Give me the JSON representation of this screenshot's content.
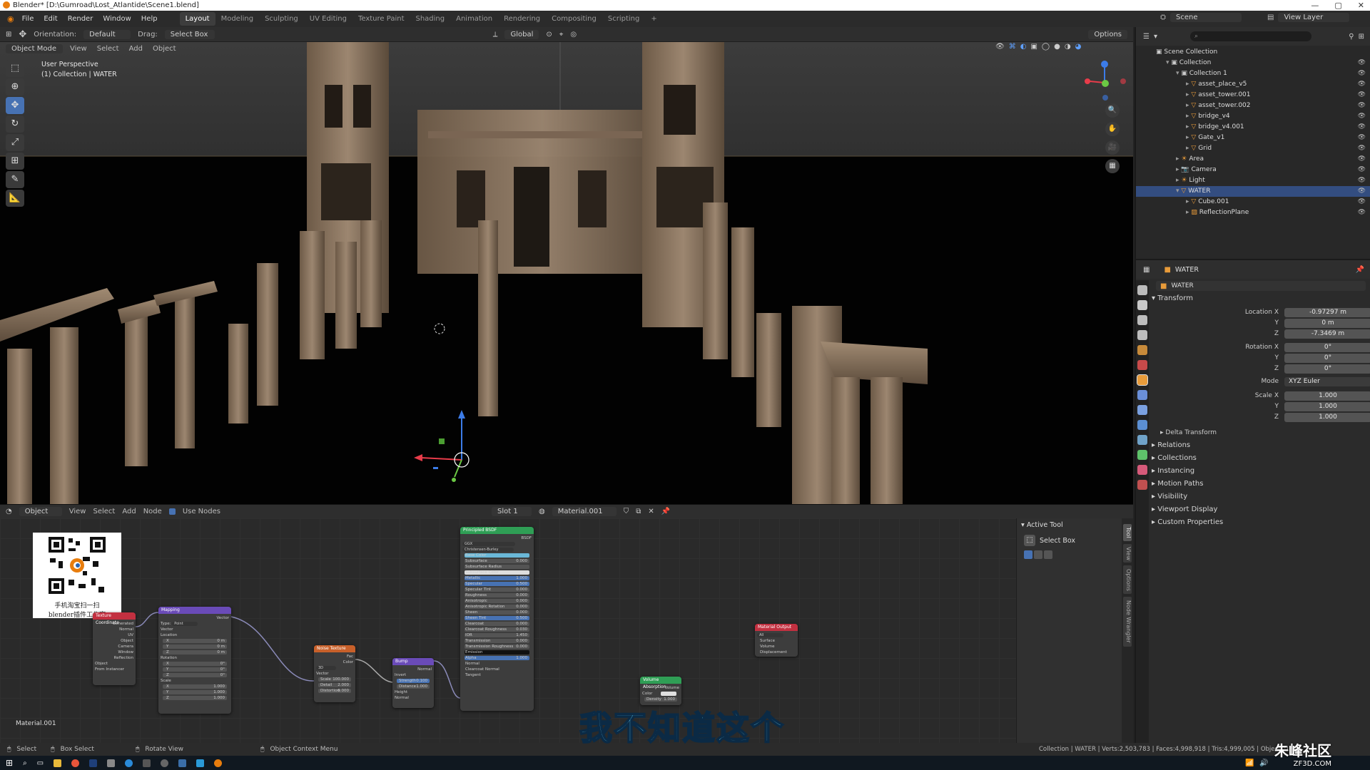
{
  "window": {
    "title": "Blender* [D:\\Gumroad\\Lost_Atlantide\\Scene1.blend]"
  },
  "menubar": {
    "menus": [
      "File",
      "Edit",
      "Render",
      "Window",
      "Help"
    ],
    "workspaces": [
      "Layout",
      "Modeling",
      "Sculpting",
      "UV Editing",
      "Texture Paint",
      "Shading",
      "Animation",
      "Rendering",
      "Compositing",
      "Scripting"
    ],
    "active_workspace": "Layout",
    "scene_label": "Scene",
    "view_layer_label": "View Layer"
  },
  "tool_header": {
    "orientation_label": "Orientation:",
    "orientation_value": "Default",
    "drag_label": "Drag:",
    "drag_value": "Select Box",
    "transform_space": "Global",
    "options_label": "Options"
  },
  "viewport": {
    "mode": "Object Mode",
    "menus": [
      "View",
      "Select",
      "Add",
      "Object"
    ],
    "info_line1": "User Perspective",
    "info_line2": "(1) Collection | WATER",
    "gizmo_axes": [
      "X",
      "Y",
      "Z"
    ]
  },
  "node_editor": {
    "object_dropdown": "Object",
    "menus": [
      "View",
      "Select",
      "Add",
      "Node"
    ],
    "use_nodes_label": "Use Nodes",
    "slot": "Slot 1",
    "material": "Material.001",
    "material_footer": "Material.001",
    "active_tool_title": "Active Tool",
    "active_tool_value": "Select Box",
    "side_tabs": [
      "Tool",
      "View",
      "Options",
      "Node Wrangler"
    ],
    "qr_caption_line1": "手机淘宝扫一扫",
    "qr_caption_line2": "blender插件工作室",
    "nodes": {
      "texcoord": {
        "title": "Texture Coordinate",
        "rows": [
          "Generated",
          "Normal",
          "UV",
          "Object",
          "Camera",
          "Window",
          "Reflection",
          "Object",
          "From Instancer"
        ]
      },
      "mapping": {
        "title": "Mapping",
        "type_label": "Type:",
        "type_value": "Point",
        "rows": [
          "Vector",
          "Location",
          "X",
          "Y",
          "Z",
          "Rotation",
          "X",
          "Y",
          "Z",
          "Scale",
          "X",
          "Y",
          "Z"
        ],
        "values": [
          "0 m",
          "0 m",
          "0 m",
          "0°",
          "0°",
          "0°",
          "1.000",
          "1.000",
          "1.000"
        ]
      },
      "noise": {
        "title": "Noise Texture",
        "outputs": [
          "Fac",
          "Color"
        ],
        "dim": "3D",
        "inputs": [
          "Vector",
          "Scale",
          "Detail",
          "Distortion"
        ],
        "values": [
          "100.000",
          "2.000",
          "0.000"
        ]
      },
      "bump": {
        "title": "Bump",
        "output": "Normal",
        "rows": [
          "Invert",
          "Strength",
          "Distance",
          "Height",
          "Normal"
        ],
        "values": [
          "0.100",
          "1.000"
        ]
      },
      "bsdf": {
        "title": "Principled BSDF",
        "output": "BSDF",
        "dist": "GGX",
        "sss": "Christensen-Burley",
        "rows": [
          "Base Color",
          "Subsurface",
          "Subsurface Radius",
          "Subsurface Color",
          "Metallic",
          "Specular",
          "Specular Tint",
          "Roughness",
          "Anisotropic",
          "Anisotropic Rotation",
          "Sheen",
          "Sheen Tint",
          "Clearcoat",
          "Clearcoat Roughness",
          "IOR",
          "Transmission",
          "Transmission Roughness",
          "Emission",
          "Alpha",
          "Normal",
          "Clearcoat Normal",
          "Tangent"
        ],
        "values": [
          "",
          "0.000",
          "",
          "",
          "1.000",
          "0.500",
          "0.000",
          "0.000",
          "0.000",
          "0.000",
          "0.000",
          "0.500",
          "0.000",
          "0.030",
          "1.450",
          "0.000",
          "0.000",
          "",
          "1.000",
          "",
          "",
          ""
        ]
      },
      "output": {
        "title": "Material Output",
        "target": "All",
        "rows": [
          "Surface",
          "Volume",
          "Displacement"
        ]
      },
      "volume": {
        "title": "Volume Absorption",
        "output": "Volume",
        "rows": [
          "Color",
          "Density"
        ],
        "values": [
          "",
          "1.000"
        ]
      }
    }
  },
  "outliner": {
    "root": "Scene Collection",
    "items": [
      {
        "name": "Collection",
        "depth": 1,
        "kind": "collection"
      },
      {
        "name": "Collection 1",
        "depth": 2,
        "kind": "collection"
      },
      {
        "name": "asset_place_v5",
        "depth": 3,
        "kind": "mesh"
      },
      {
        "name": "asset_tower.001",
        "depth": 3,
        "kind": "mesh"
      },
      {
        "name": "asset_tower.002",
        "depth": 3,
        "kind": "mesh"
      },
      {
        "name": "bridge_v4",
        "depth": 3,
        "kind": "mesh"
      },
      {
        "name": "bridge_v4.001",
        "depth": 3,
        "kind": "mesh"
      },
      {
        "name": "Gate_v1",
        "depth": 3,
        "kind": "mesh"
      },
      {
        "name": "Grid",
        "depth": 3,
        "kind": "mesh"
      },
      {
        "name": "Area",
        "depth": 2,
        "kind": "light"
      },
      {
        "name": "Camera",
        "depth": 2,
        "kind": "camera"
      },
      {
        "name": "Light",
        "depth": 2,
        "kind": "light"
      },
      {
        "name": "WATER",
        "depth": 2,
        "kind": "selected"
      },
      {
        "name": "Cube.001",
        "depth": 3,
        "kind": "mesh"
      },
      {
        "name": "ReflectionPlane",
        "depth": 3,
        "kind": "probe"
      }
    ]
  },
  "properties": {
    "object_name": "WATER",
    "object_field": "WATER",
    "transform_title": "Transform",
    "location_label": "Location X",
    "location": [
      "-0.97297 m",
      "0 m",
      "-7.3469 m"
    ],
    "rotation_label": "Rotation X",
    "rotation": [
      "0°",
      "0°",
      "0°"
    ],
    "mode_label": "Mode",
    "mode_value": "XYZ Euler",
    "scale_label": "Scale X",
    "scale": [
      "1.000",
      "1.000",
      "1.000"
    ],
    "axis_y": "Y",
    "axis_z": "Z",
    "delta_transform": "Delta Transform",
    "panels": [
      "Relations",
      "Collections",
      "Instancing",
      "Motion Paths",
      "Visibility",
      "Viewport Display",
      "Custom Properties"
    ]
  },
  "statusbar": {
    "select": "Select",
    "box_select": "Box Select",
    "rotate_view": "Rotate View",
    "context_menu": "Object Context Menu",
    "stats": "Collection | WATER | Verts:2,503,783 | Faces:4,998,918 | Tris:4,999,005 | Objects:1/1"
  },
  "overlay": {
    "subtitle": "我不知道这个",
    "watermark": "朱峰社区",
    "watermark_url": "ZF3D.COM"
  }
}
